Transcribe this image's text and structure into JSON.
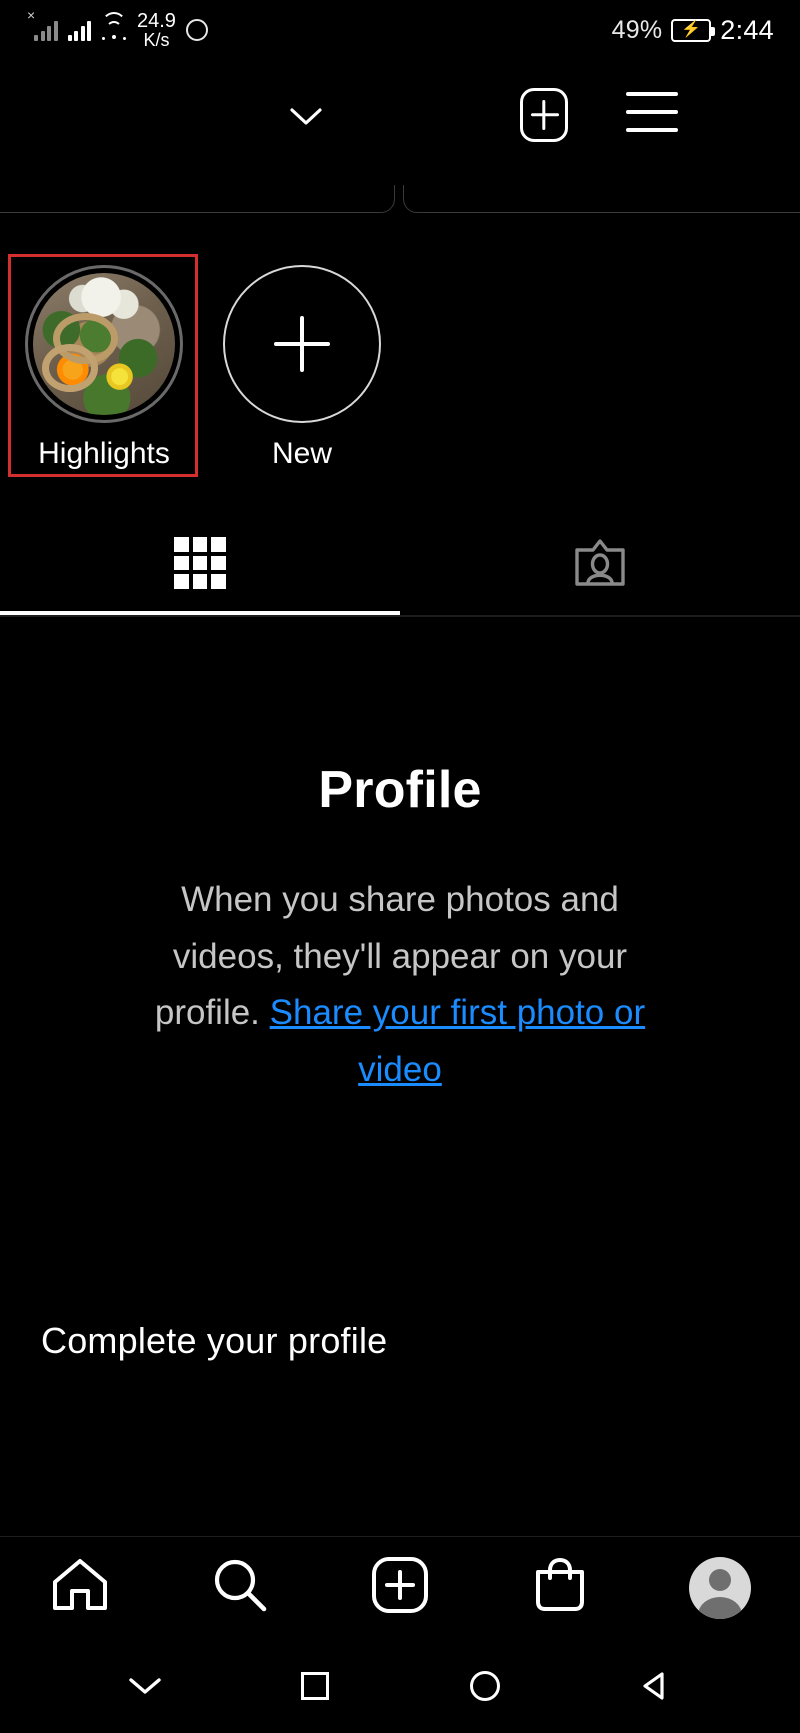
{
  "status_bar": {
    "network_speed_value": "24.9",
    "network_speed_unit": "K/s",
    "battery_percent": "49%",
    "clock": "2:44",
    "icons": {
      "signal_disabled": "signal-bars-disabled-icon",
      "signal": "signal-bars-icon",
      "wifi": "wifi-icon",
      "ring": "circle-indicator-icon",
      "battery": "battery-charging-icon"
    }
  },
  "header": {
    "chevron_icon": "chevron-down-icon",
    "add_icon": "add-post-icon",
    "menu_icon": "hamburger-menu-icon"
  },
  "highlights": {
    "items": [
      {
        "label": "Highlights",
        "thumb": "flower-pots-photo",
        "selected": true
      },
      {
        "label": "New",
        "icon": "plus-icon",
        "selected": false
      }
    ],
    "selection_color": "#d32f2f"
  },
  "tabs": {
    "active_index": 0,
    "items": [
      {
        "name": "grid",
        "icon": "grid-icon",
        "label": ""
      },
      {
        "name": "tagged",
        "icon": "tagged-person-icon",
        "label": ""
      }
    ]
  },
  "empty_state": {
    "title": "Profile",
    "body": "When you share photos and videos, they'll appear on your profile.",
    "link": "Share your first photo or video",
    "link_color": "#1a8cff"
  },
  "complete_profile": {
    "title": "Complete your profile"
  },
  "bottom_nav": {
    "items": [
      {
        "name": "home",
        "icon": "home-icon"
      },
      {
        "name": "search",
        "icon": "search-icon"
      },
      {
        "name": "create",
        "icon": "add-post-icon"
      },
      {
        "name": "shop",
        "icon": "shop-bag-icon"
      },
      {
        "name": "profile",
        "icon": "avatar-icon"
      }
    ],
    "active": "profile"
  },
  "system_nav": {
    "items": [
      {
        "name": "hide-keyboard",
        "icon": "chevron-down-icon"
      },
      {
        "name": "recents",
        "icon": "square-icon"
      },
      {
        "name": "home",
        "icon": "circle-icon"
      },
      {
        "name": "back",
        "icon": "triangle-back-icon"
      }
    ]
  }
}
